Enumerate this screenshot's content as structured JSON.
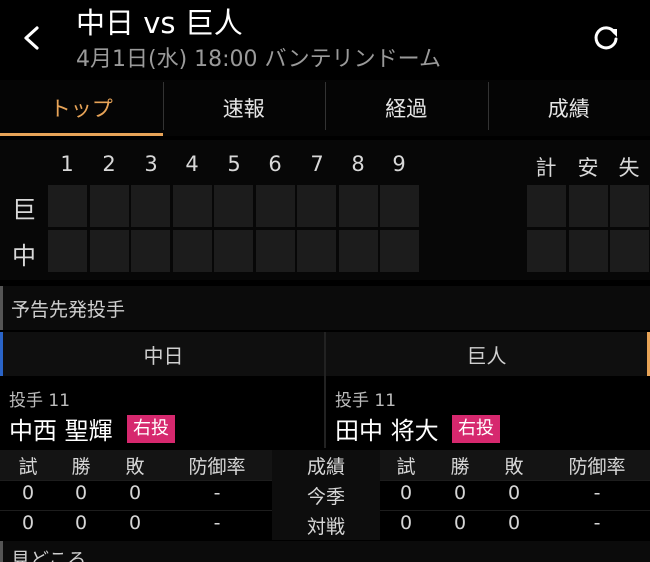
{
  "header": {
    "title": "中日 vs 巨人",
    "subtitle": "4月1日(水) 18:00 バンテリンドーム"
  },
  "tabs": [
    "トップ",
    "速報",
    "経過",
    "成績"
  ],
  "scoreboard": {
    "innings": [
      "1",
      "2",
      "3",
      "4",
      "5",
      "6",
      "7",
      "8",
      "9"
    ],
    "totals": [
      "計",
      "安",
      "失"
    ],
    "teams": [
      "巨",
      "中"
    ]
  },
  "probable": {
    "section_title": "予告先発投手",
    "home_team": "中日",
    "away_team": "巨人",
    "home": {
      "position": "投手 11",
      "name": "中西 聖輝",
      "hand": "右投"
    },
    "away": {
      "position": "投手 11",
      "name": "田中 将大",
      "hand": "右投"
    }
  },
  "stats": {
    "headers": [
      "試",
      "勝",
      "敗",
      "防御率"
    ],
    "mid_header": "成績",
    "rows": [
      {
        "label": "今季",
        "home": [
          "0",
          "0",
          "0",
          "-"
        ],
        "away": [
          "0",
          "0",
          "0",
          "-"
        ]
      },
      {
        "label": "対戦",
        "home": [
          "0",
          "0",
          "0",
          "-"
        ],
        "away": [
          "0",
          "0",
          "0",
          "-"
        ]
      }
    ]
  },
  "bottom_section_title": "見どころ",
  "colors": {
    "accent": "#e8a458",
    "home": "#2a64c8",
    "badge": "#d6286e"
  },
  "icons": {
    "back": "chevron-left-icon",
    "reload": "reload-icon"
  }
}
